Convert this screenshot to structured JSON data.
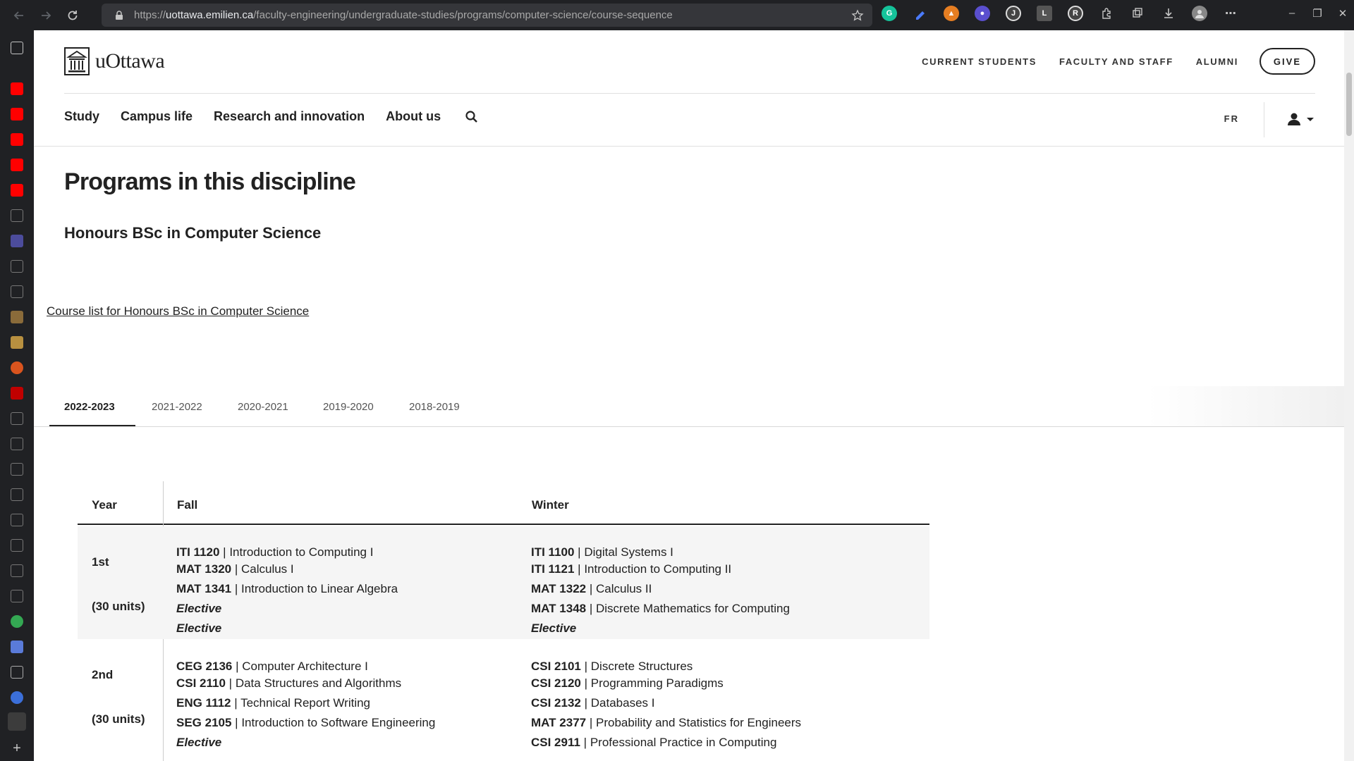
{
  "browser": {
    "url_prefix": "https://",
    "url_host": "uottawa.emilien.ca",
    "url_path": "/faculty-engineering/undergraduate-studies/programs/computer-science/course-sequence"
  },
  "header": {
    "logo_text": "uOttawa",
    "utility_links": [
      "CURRENT STUDENTS",
      "FACULTY AND STAFF",
      "ALUMNI"
    ],
    "give_label": "GIVE"
  },
  "nav": {
    "items": [
      "Study",
      "Campus life",
      "Research and innovation",
      "About us"
    ],
    "lang": "FR"
  },
  "content": {
    "heading": "Programs in this discipline",
    "subheading": "Honours BSc in Computer Science",
    "course_list_link": "Course list for Honours BSc in Computer Science"
  },
  "tabs": [
    "2022-2023",
    "2021-2022",
    "2020-2021",
    "2019-2020",
    "2018-2019"
  ],
  "table": {
    "headers": {
      "year": "Year",
      "fall": "Fall",
      "winter": "Winter"
    },
    "rows": [
      {
        "year": "1st",
        "units": "(30 units)",
        "fall": [
          {
            "code": "ITI 1120",
            "name": "Introduction to Computing I"
          },
          {
            "code": "MAT 1320",
            "name": "Calculus I"
          },
          {
            "code": "MAT 1341",
            "name": "Introduction to Linear Algebra"
          },
          {
            "elective": "Elective"
          },
          {
            "elective": "Elective"
          }
        ],
        "winter": [
          {
            "code": "ITI 1100",
            "name": "Digital Systems I"
          },
          {
            "code": "ITI 1121",
            "name": "Introduction to Computing II"
          },
          {
            "code": "MAT 1322",
            "name": "Calculus II"
          },
          {
            "code": "MAT 1348",
            "name": "Discrete Mathematics for Computing"
          },
          {
            "elective": "Elective"
          }
        ]
      },
      {
        "year": "2nd",
        "units": "(30 units)",
        "fall": [
          {
            "code": "CEG 2136",
            "name": "Computer Architecture I"
          },
          {
            "code": "CSI 2110",
            "name": "Data Structures and Algorithms"
          },
          {
            "code": "ENG 1112",
            "name": "Technical Report Writing"
          },
          {
            "code": "SEG 2105",
            "name": "Introduction to Software Engineering"
          },
          {
            "elective": "Elective"
          }
        ],
        "winter": [
          {
            "code": "CSI 2101",
            "name": "Discrete Structures"
          },
          {
            "code": "CSI 2120",
            "name": "Programming Paradigms"
          },
          {
            "code": "CSI 2132",
            "name": "Databases I"
          },
          {
            "code": "MAT 2377",
            "name": "Probability and Statistics for Engineers"
          },
          {
            "code": "CSI 2911",
            "name": "Professional Practice in Computing"
          }
        ]
      }
    ]
  }
}
